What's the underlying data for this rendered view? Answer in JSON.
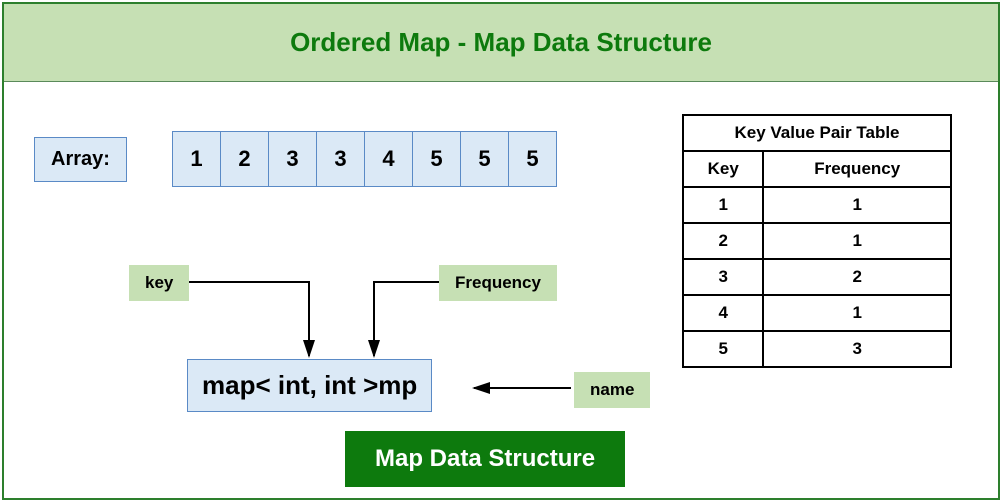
{
  "header": {
    "title": "Ordered Map - Map Data Structure"
  },
  "array": {
    "label": "Array:",
    "values": [
      "1",
      "2",
      "3",
      "3",
      "4",
      "5",
      "5",
      "5"
    ]
  },
  "tags": {
    "key": "key",
    "frequency": "Frequency",
    "name": "name"
  },
  "map_declaration": "map< int, int >mp",
  "footer": "Map Data Structure",
  "kv_table": {
    "title": "Key Value Pair Table",
    "col_key": "Key",
    "col_freq": "Frequency",
    "rows": [
      {
        "k": "1",
        "f": "1"
      },
      {
        "k": "2",
        "f": "1"
      },
      {
        "k": "3",
        "f": "2"
      },
      {
        "k": "4",
        "f": "1"
      },
      {
        "k": "5",
        "f": "3"
      }
    ]
  }
}
